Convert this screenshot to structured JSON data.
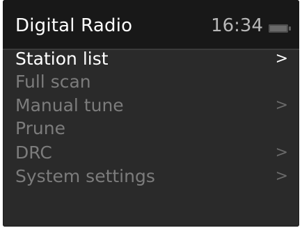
{
  "header": {
    "title": "Digital Radio",
    "time": "16:34",
    "battery_icon": "battery-icon"
  },
  "menu": {
    "items": [
      {
        "label": "Station list",
        "chevron": ">"
      },
      {
        "label": "Full scan",
        "chevron": ""
      },
      {
        "label": "Manual tune",
        "chevron": ">"
      },
      {
        "label": "Prune",
        "chevron": ""
      },
      {
        "label": "DRC",
        "chevron": ">"
      },
      {
        "label": "System settings",
        "chevron": ">"
      }
    ],
    "selected_index": 0
  },
  "colors": {
    "screen_bg": "#2a2a2a",
    "header_bg": "#181818",
    "active_text": "#ffffff",
    "inactive_text": "#7c7c7c"
  }
}
